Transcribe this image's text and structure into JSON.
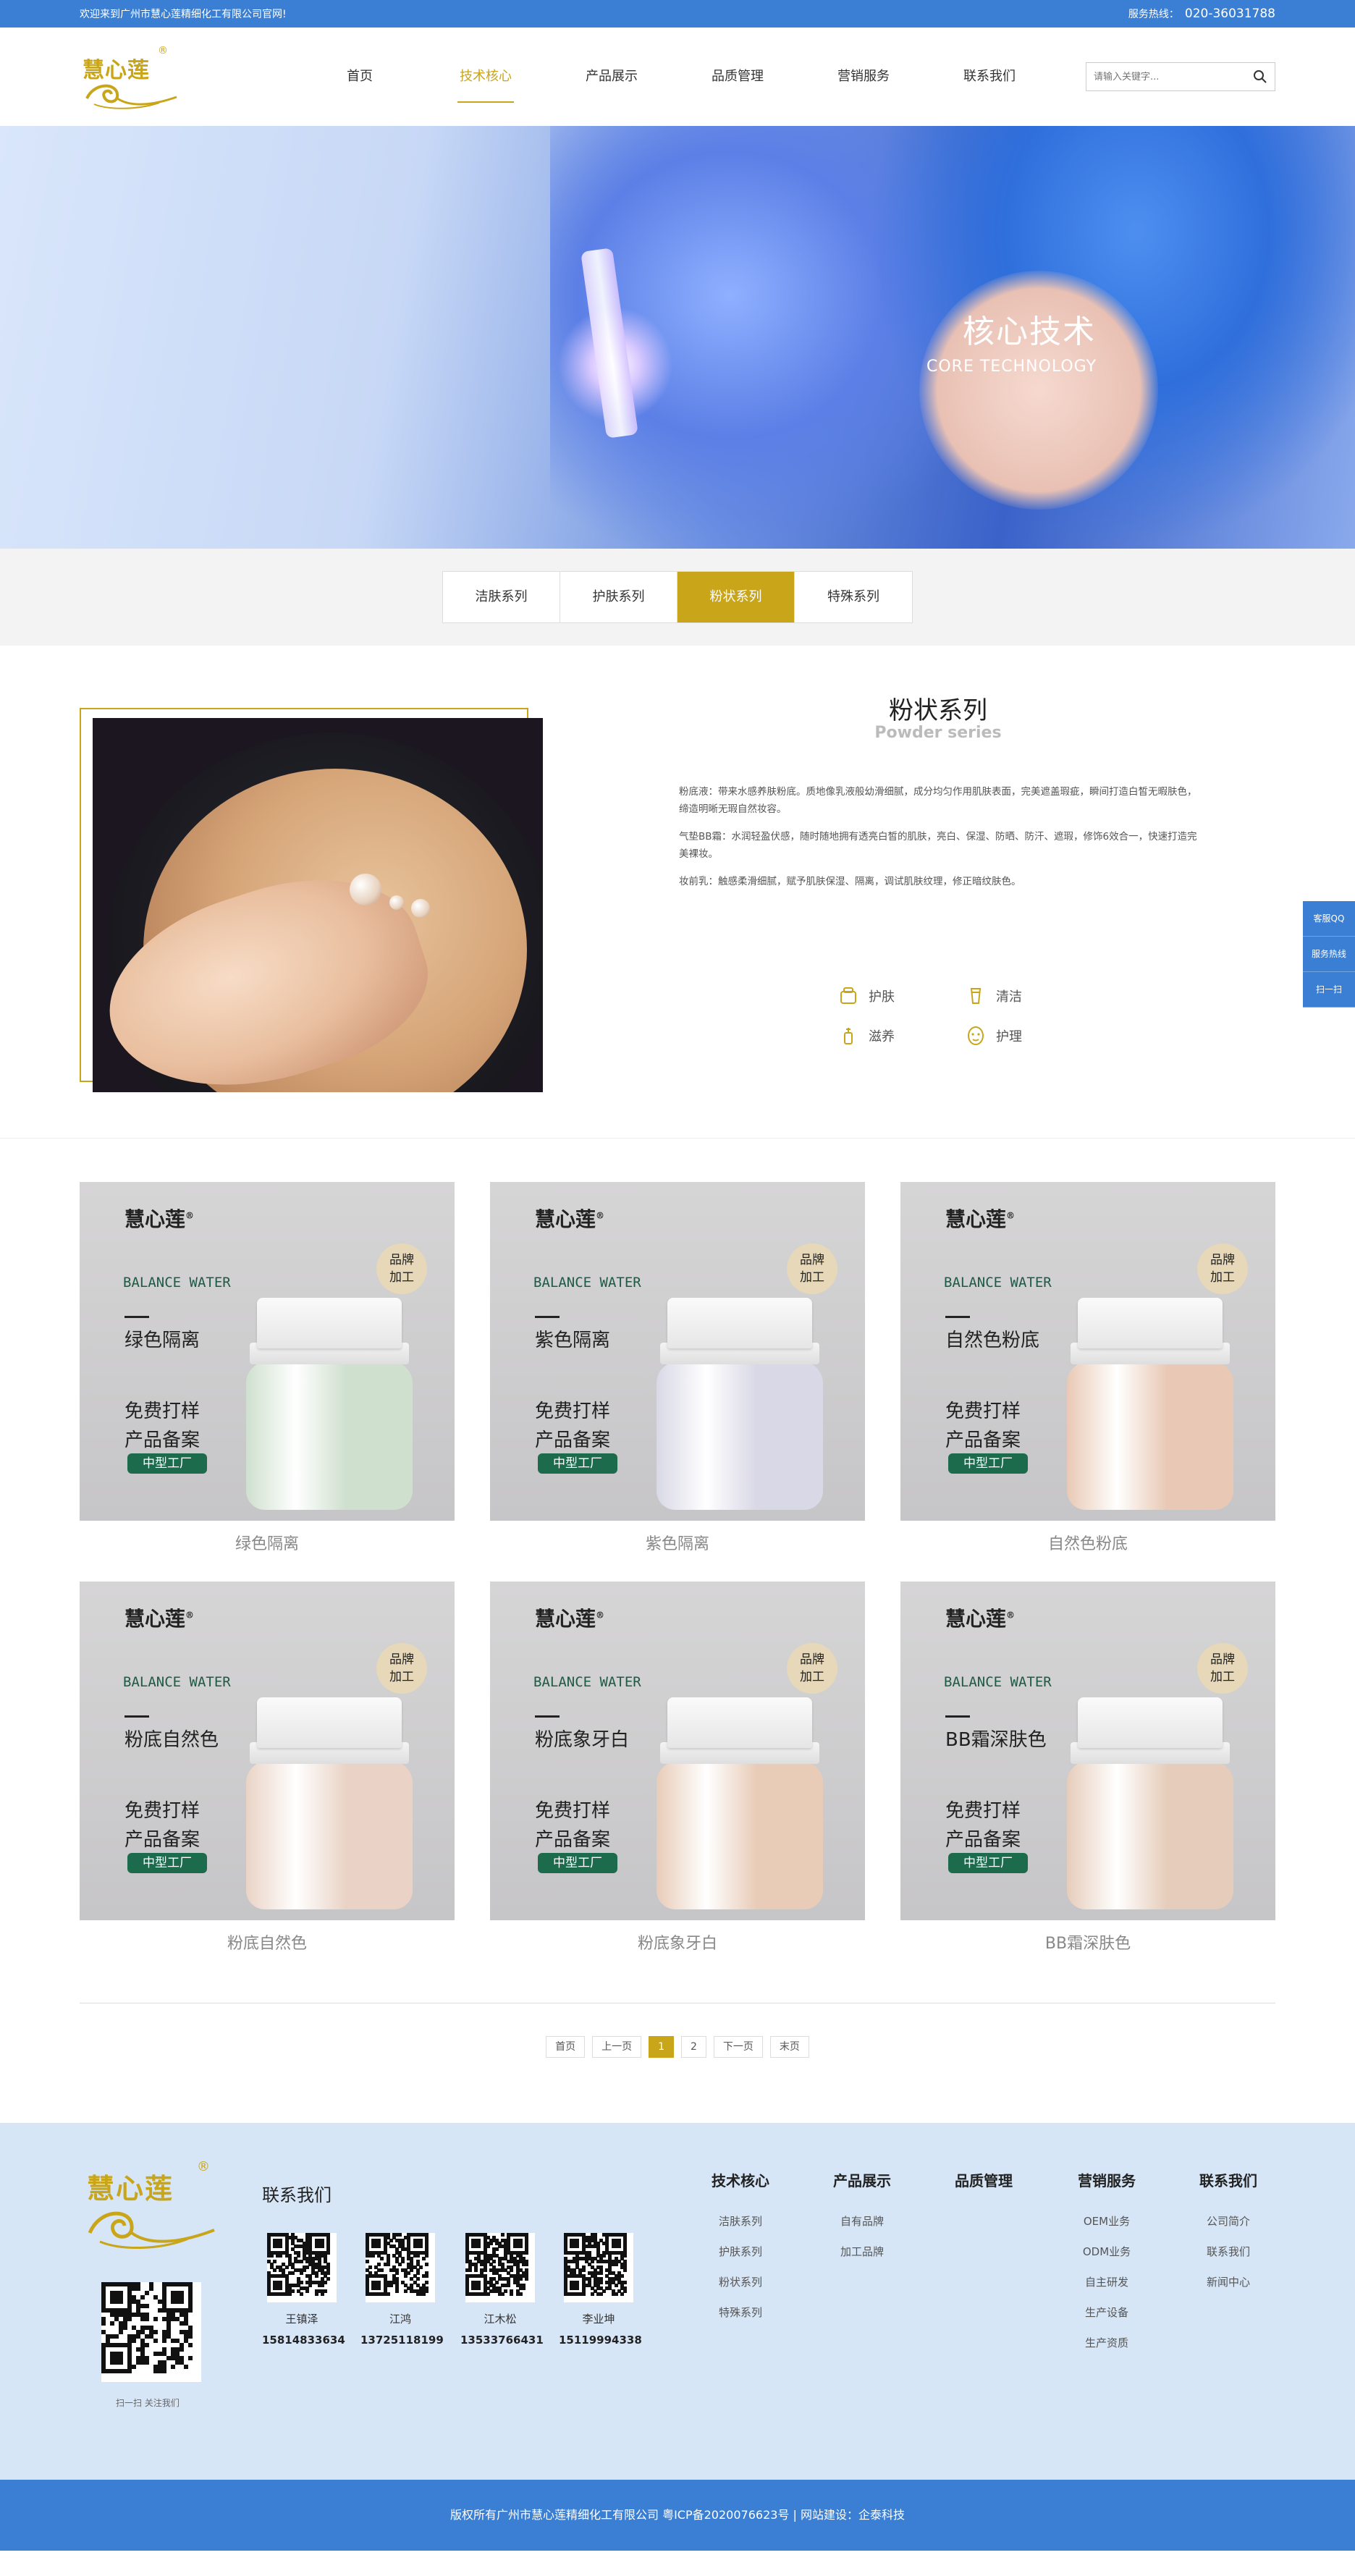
{
  "topbar": {
    "welcome": "欢迎来到广州市慧心莲精细化工有限公司官网!",
    "hotline_label": "服务热线：",
    "hotline": "020-36031788"
  },
  "logo": {
    "text": "慧心莲",
    "reg": "®"
  },
  "nav": [
    {
      "label": "首页"
    },
    {
      "label": "技术核心"
    },
    {
      "label": "产品展示"
    },
    {
      "label": "品质管理"
    },
    {
      "label": "营销服务"
    },
    {
      "label": "联系我们"
    }
  ],
  "search": {
    "placeholder": "请输入关键字..."
  },
  "banner": {
    "title": "核心技术",
    "subtitle": "CORE TECHNOLOGY"
  },
  "tabs": [
    {
      "label": "洁肤系列"
    },
    {
      "label": "护肤系列"
    },
    {
      "label": "粉状系列"
    },
    {
      "label": "特殊系列"
    }
  ],
  "intro": {
    "title": "粉状系列",
    "title_en": "Powder series",
    "paragraphs": [
      "粉底液：带来水感养肤粉底。质地像乳液般幼滑细腻，成分均匀作用肌肤表面，完美遮盖瑕疵，瞬间打造白皙无暇肤色，缔造明晰无瑕自然妆容。",
      "气垫BB霜：水润轻盈伏感，随时随地拥有透亮白皙的肌肤，亮白、保湿、防晒、防汗、遮瑕，修饰6效合一，快速打造完美裸妆。",
      "妆前乳：触感柔滑细腻，赋予肌肤保湿、隔离，调试肌肤纹理，修正暗纹肤色。"
    ],
    "features": [
      {
        "label": "护肤",
        "icon": "skincare-icon"
      },
      {
        "label": "清洁",
        "icon": "cleanse-icon"
      },
      {
        "label": "滋养",
        "icon": "nourish-icon"
      },
      {
        "label": "护理",
        "icon": "care-icon"
      }
    ]
  },
  "side": {
    "qq": "客服QQ",
    "hotline": "服务热线",
    "scan": "扫一扫"
  },
  "product_common": {
    "brand": "慧心莲",
    "balance": "BALANCE WATER",
    "free1": "免费打样",
    "free2": "产品备案",
    "tag": "中型工厂",
    "badge1": "品牌",
    "badge2": "加工"
  },
  "products": [
    {
      "name": "绿色隔离",
      "color": "#cfe0cf"
    },
    {
      "name": "紫色隔离",
      "color": "#d9d8e6"
    },
    {
      "name": "自然色粉底",
      "color": "#e9c9b5"
    },
    {
      "name": "粉底自然色",
      "color": "#ead3c6"
    },
    {
      "name": "粉底象牙白",
      "color": "#e8ccb8"
    },
    {
      "name": "BB霜深肤色",
      "color": "#e6cdbb"
    }
  ],
  "pagination": {
    "first": "首页",
    "prev": "上一页",
    "p1": "1",
    "p2": "2",
    "next": "下一页",
    "last": "末页"
  },
  "footer": {
    "contact_title": "联系我们",
    "scan_text": "扫一扫 关注我们",
    "people": [
      {
        "name": "王镇泽",
        "phone": "15814833634"
      },
      {
        "name": "江鸿",
        "phone": "13725118199"
      },
      {
        "name": "江木松",
        "phone": "13533766431"
      },
      {
        "name": "李业坤",
        "phone": "15119994338"
      }
    ],
    "columns": [
      {
        "title": "技术核心",
        "items": [
          "洁肤系列",
          "护肤系列",
          "粉状系列",
          "特殊系列"
        ]
      },
      {
        "title": "产品展示",
        "items": [
          "自有品牌",
          "加工品牌"
        ]
      },
      {
        "title": "品质管理",
        "items": []
      },
      {
        "title": "营销服务",
        "items": [
          "OEM业务",
          "ODM业务",
          "自主研发",
          "生产设备",
          "生产资质"
        ]
      },
      {
        "title": "联系我们",
        "items": [
          "公司简介",
          "联系我们",
          "新闻中心"
        ]
      }
    ],
    "copyright": "版权所有广州市慧心莲精细化工有限公司 粤ICP备2020076623号    |    网站建设：企泰科技"
  },
  "colors": {
    "brand_gold": "#c9a51a",
    "brand_blue": "#3a7fd3",
    "tag_green": "#1d6b4d"
  }
}
